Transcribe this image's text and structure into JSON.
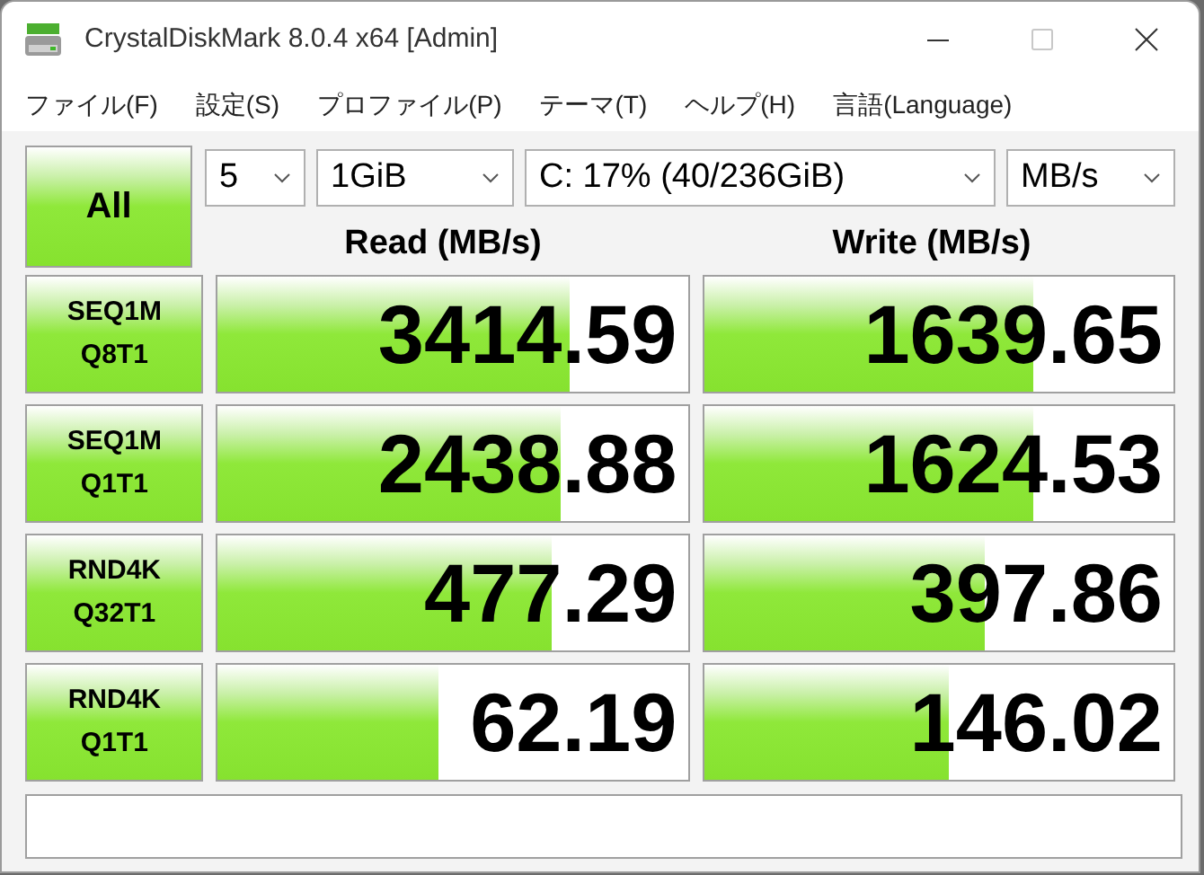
{
  "window": {
    "title": "CrystalDiskMark 8.0.4 x64 [Admin]"
  },
  "menu": [
    "ファイル(F)",
    "設定(S)",
    "プロファイル(P)",
    "テーマ(T)",
    "ヘルプ(H)",
    "言語(Language)"
  ],
  "all_button": "All",
  "selects": [
    {
      "value": "5"
    },
    {
      "value": "1GiB"
    },
    {
      "value": "C: 17% (40/236GiB)"
    },
    {
      "value": "MB/s"
    }
  ],
  "headers": {
    "read": "Read (MB/s)",
    "write": "Write (MB/s)"
  },
  "rows": [
    {
      "test": [
        "SEQ1M",
        "Q8T1"
      ],
      "read": {
        "value": "3414.59",
        "level": 0.75
      },
      "write": {
        "value": "1639.65",
        "level": 0.7
      }
    },
    {
      "test": [
        "SEQ1M",
        "Q1T1"
      ],
      "read": {
        "value": "2438.88",
        "level": 0.73
      },
      "write": {
        "value": "1624.53",
        "level": 0.7
      }
    },
    {
      "test": [
        "RND4K",
        "Q32T1"
      ],
      "read": {
        "value": "477.29",
        "level": 0.71
      },
      "write": {
        "value": "397.86",
        "level": 0.6
      }
    },
    {
      "test": [
        "RND4K",
        "Q1T1"
      ],
      "read": {
        "value": "62.19",
        "level": 0.47
      },
      "write": {
        "value": "146.02",
        "level": 0.52
      }
    }
  ]
}
